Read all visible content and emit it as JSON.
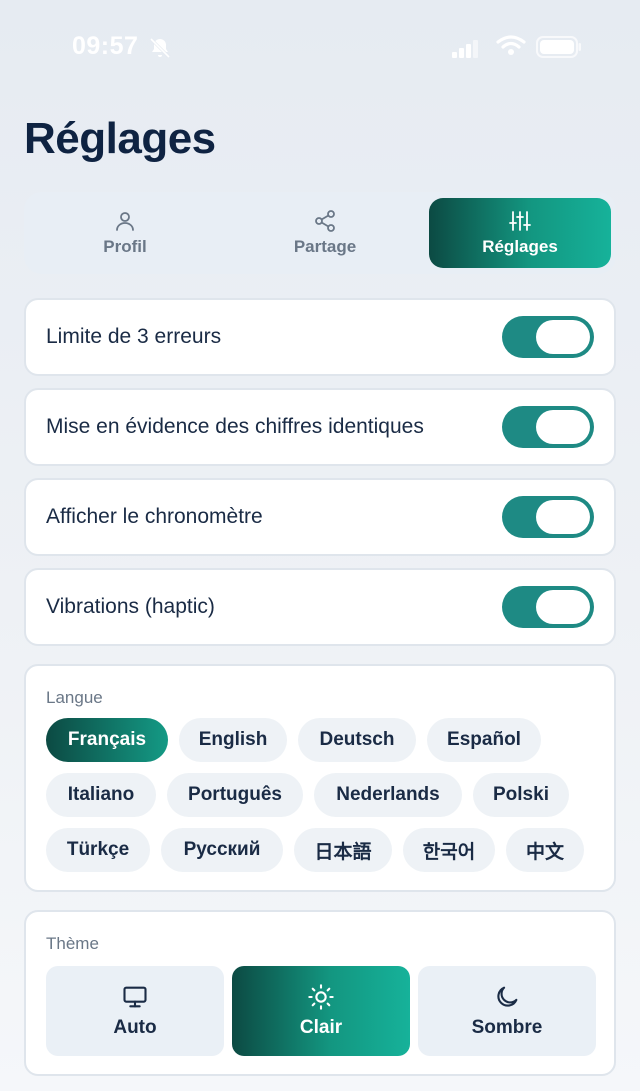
{
  "status": {
    "time": "09:57"
  },
  "page": {
    "title": "Réglages"
  },
  "tabs": [
    {
      "label": "Profil",
      "icon": "user-icon",
      "active": false
    },
    {
      "label": "Partage",
      "icon": "share-icon",
      "active": false
    },
    {
      "label": "Réglages",
      "icon": "sliders-icon",
      "active": true
    }
  ],
  "toggles": [
    {
      "label": "Limite de 3 erreurs",
      "on": true
    },
    {
      "label": "Mise en évidence des chiffres identiques",
      "on": true
    },
    {
      "label": "Afficher le chronomètre",
      "on": true
    },
    {
      "label": "Vibrations (haptic)",
      "on": true
    }
  ],
  "language": {
    "label": "Langue",
    "selected": "Français",
    "options": [
      "Français",
      "English",
      "Deutsch",
      "Español",
      "Italiano",
      "Português",
      "Nederlands",
      "Polski",
      "Türkçe",
      "Русский",
      "日本語",
      "한국어",
      "中文"
    ]
  },
  "theme": {
    "label": "Thème",
    "selected": "Clair",
    "options": [
      {
        "label": "Auto",
        "icon": "monitor-icon"
      },
      {
        "label": "Clair",
        "icon": "sun-icon"
      },
      {
        "label": "Sombre",
        "icon": "moon-icon"
      }
    ]
  },
  "colors": {
    "accent": "#1e8a84",
    "accent_dark": "#0c4a43",
    "title": "#0f2342"
  }
}
